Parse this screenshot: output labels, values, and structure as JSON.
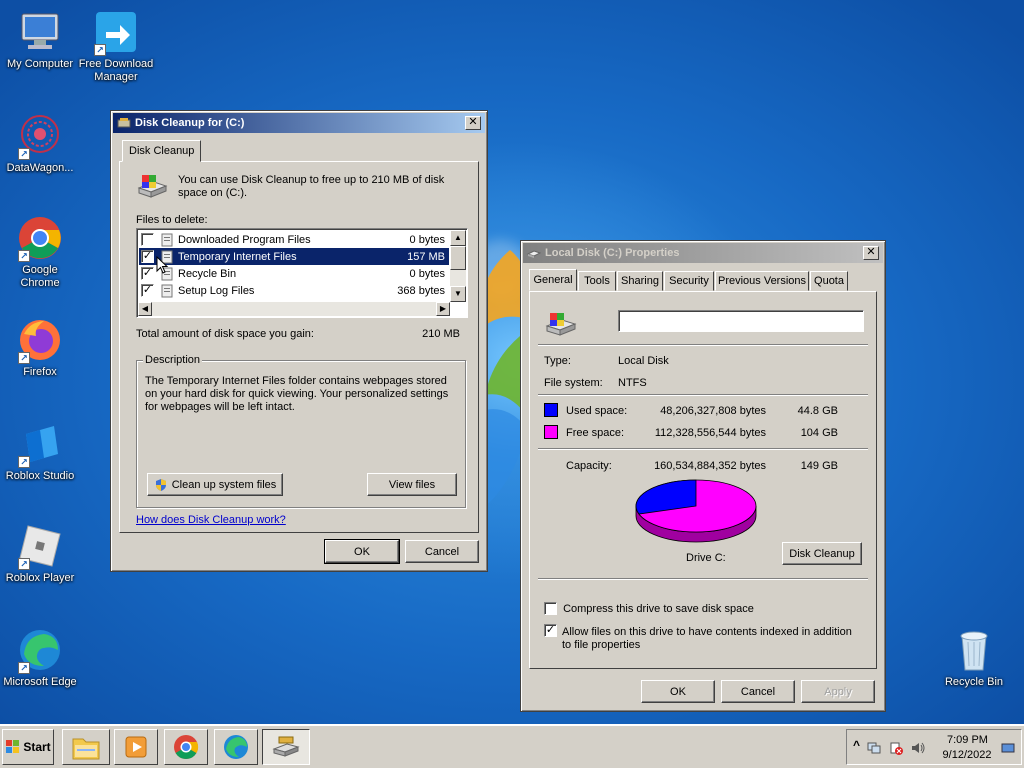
{
  "desktop": {
    "icons": [
      {
        "label": "My Computer",
        "icon": "my-computer-icon"
      },
      {
        "label": "Free Download Manager",
        "icon": "free-download-manager-icon"
      },
      {
        "label": "DataWagon...",
        "icon": "datawagon-icon"
      },
      {
        "label": "Google Chrome",
        "icon": "chrome-icon"
      },
      {
        "label": "Firefox",
        "icon": "firefox-icon"
      },
      {
        "label": "Roblox Studio",
        "icon": "roblox-studio-icon"
      },
      {
        "label": "Roblox Player",
        "icon": "roblox-player-icon"
      },
      {
        "label": "Microsoft Edge",
        "icon": "edge-icon"
      },
      {
        "label": "Recycle Bin",
        "icon": "recycle-bin-icon"
      }
    ]
  },
  "cleanup": {
    "title": "Disk Cleanup for  (C:)",
    "tab": "Disk Cleanup",
    "intro": "You can use Disk Cleanup to free up to 210 MB of disk space on  (C:).",
    "files_label": "Files to delete:",
    "files": [
      {
        "name": "Downloaded Program Files",
        "size": "0 bytes",
        "checked": false
      },
      {
        "name": "Temporary Internet Files",
        "size": "157 MB",
        "checked": true
      },
      {
        "name": "Recycle Bin",
        "size": "0 bytes",
        "checked": true
      },
      {
        "name": "Setup Log Files",
        "size": "368 bytes",
        "checked": true
      }
    ],
    "total_label": "Total amount of disk space you gain:",
    "total_value": "210 MB",
    "description_label": "Description",
    "description": "The Temporary Internet Files folder contains webpages stored on your hard disk for quick viewing. Your personalized settings for webpages will be left intact.",
    "clean_system_label": "Clean up system files",
    "view_files_label": "View files",
    "help_link": "How does Disk Cleanup work?",
    "ok_label": "OK",
    "cancel_label": "Cancel"
  },
  "props": {
    "title": "Local Disk (C:) Properties",
    "tabs": [
      "General",
      "Tools",
      "Sharing",
      "Security",
      "Previous Versions",
      "Quota"
    ],
    "volume_name": "",
    "type_label": "Type:",
    "type_value": "Local Disk",
    "fs_label": "File system:",
    "fs_value": "NTFS",
    "used_label": "Used space:",
    "used_bytes": "48,206,327,808 bytes",
    "used_gb": "44.8 GB",
    "free_label": "Free space:",
    "free_bytes": "112,328,556,544 bytes",
    "free_gb": "104 GB",
    "capacity_label": "Capacity:",
    "capacity_bytes": "160,534,884,352 bytes",
    "capacity_gb": "149 GB",
    "used_fraction": 0.3,
    "used_color": "#0000ff",
    "free_color": "#ff00ff",
    "drive_label": "Drive C:",
    "disk_cleanup_label": "Disk Cleanup",
    "compress_label": "Compress this drive to save disk space",
    "index_label": "Allow files on this drive to have contents indexed in addition to file properties",
    "ok_label": "OK",
    "cancel_label": "Cancel",
    "apply_label": "Apply"
  },
  "taskbar": {
    "start_label": "Start",
    "time": "7:09 PM",
    "date": "9/12/2022",
    "tray_expand": "^"
  }
}
